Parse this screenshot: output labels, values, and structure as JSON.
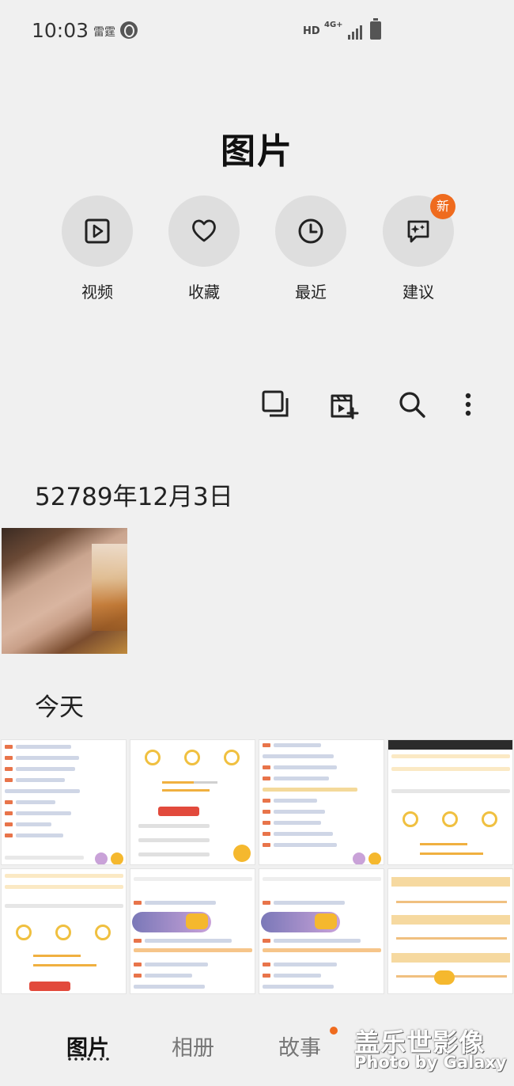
{
  "status_bar": {
    "time": "10:03",
    "carrier": "雷霆",
    "hd": "HD",
    "network": "4G+"
  },
  "page_title": "图片",
  "quick_actions": [
    {
      "label": "视频",
      "icon": "video-icon"
    },
    {
      "label": "收藏",
      "icon": "heart-icon"
    },
    {
      "label": "最近",
      "icon": "clock-icon"
    },
    {
      "label": "建议",
      "icon": "suggestion-icon",
      "badge": "新"
    }
  ],
  "toolbar": {
    "icons": [
      "select-icon",
      "create-movie-icon",
      "search-icon",
      "more-icon"
    ]
  },
  "sections": [
    {
      "title": "52789年12月3日"
    },
    {
      "title": "今天"
    }
  ],
  "bottom_nav": {
    "items": [
      "图片",
      "相册",
      "故事"
    ],
    "active": "图片"
  },
  "watermark": {
    "cn": "盖乐世影像",
    "en": "Photo by Galaxy"
  },
  "colors": {
    "background": "#f0f0f0",
    "badge": "#ef6b1e",
    "icon_circle": "#dedede"
  }
}
